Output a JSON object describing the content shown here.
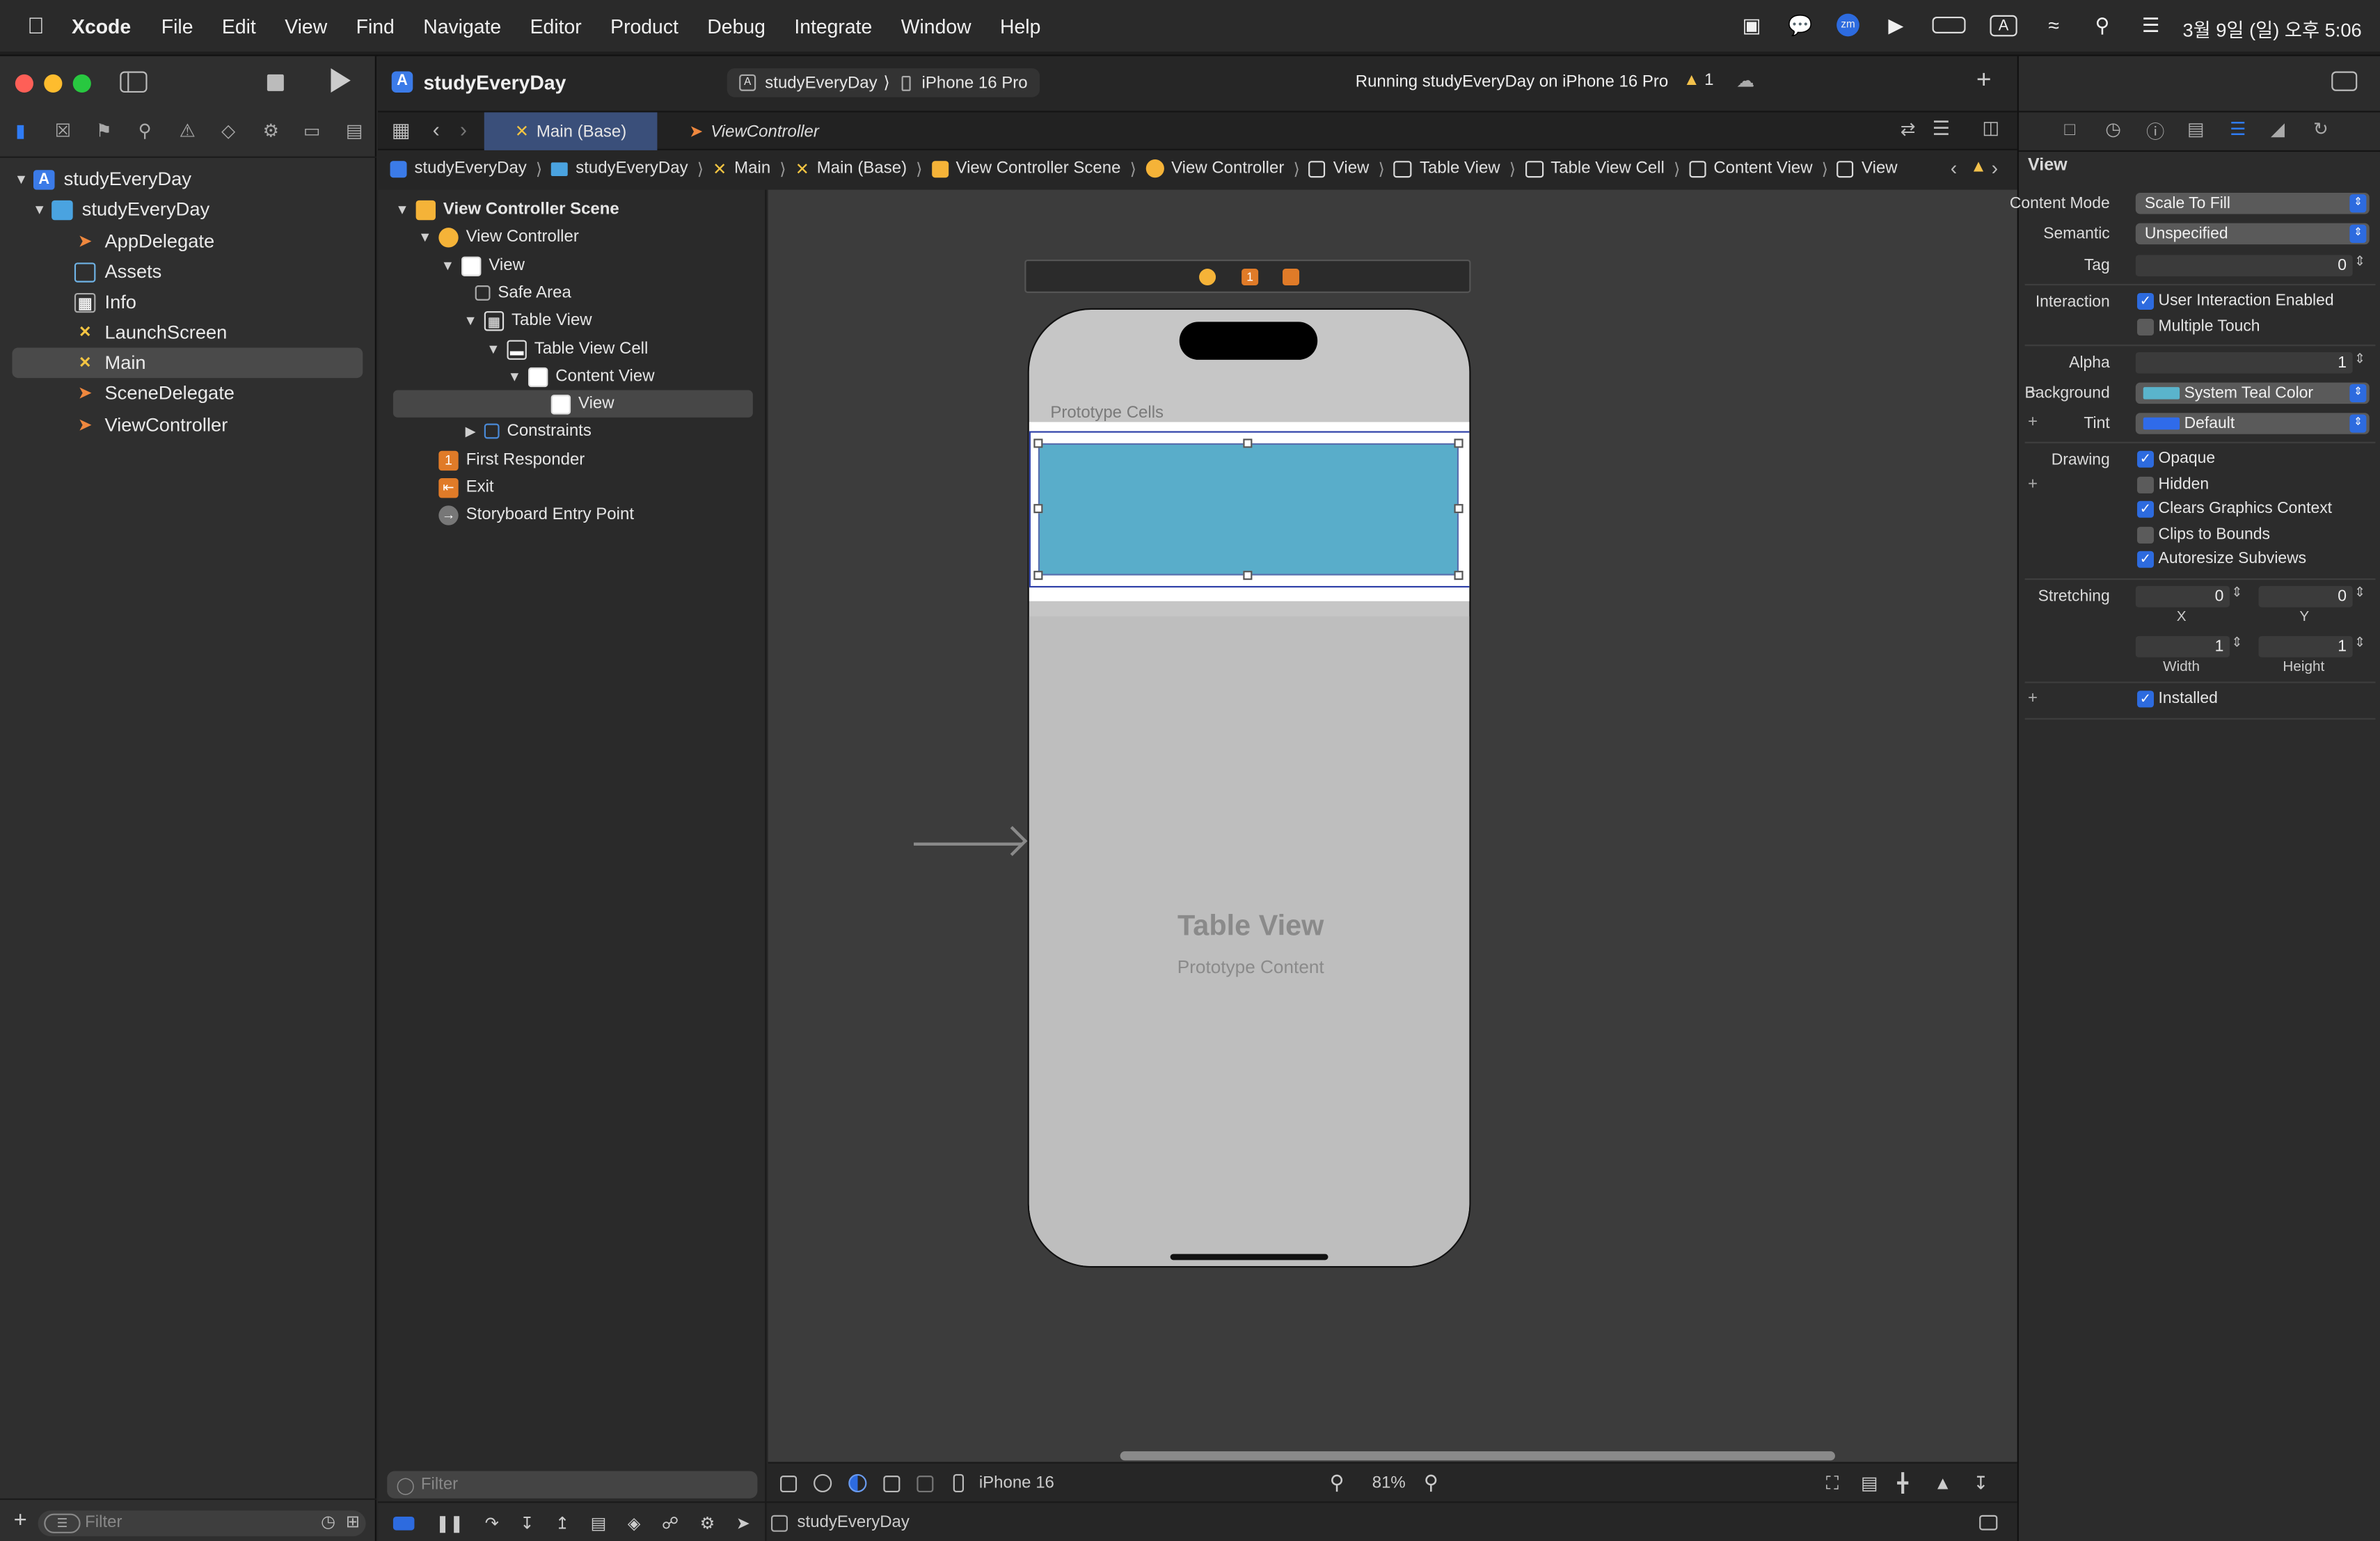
{
  "menubar": {
    "app": "Xcode",
    "items": [
      "File",
      "Edit",
      "View",
      "Find",
      "Navigate",
      "Editor",
      "Product",
      "Debug",
      "Integrate",
      "Window",
      "Help"
    ],
    "clock": "3월 9일 (일) 오후 5:06",
    "input_source": "A"
  },
  "toolbar": {
    "project": "studyEveryDay",
    "scheme": "studyEveryDay",
    "device": "iPhone 16 Pro",
    "status": "Running studyEveryDay on iPhone 16 Pro",
    "warning_count": "1"
  },
  "navigator": {
    "items": [
      {
        "label": "studyEveryDay",
        "icon": "project-icon",
        "level": 0,
        "chev": "⌄"
      },
      {
        "label": "studyEveryDay",
        "icon": "folder-icon",
        "level": 1,
        "chev": "⌄"
      },
      {
        "label": "AppDelegate",
        "icon": "swift-file-icon",
        "level": 2
      },
      {
        "label": "Assets",
        "icon": "assets-icon",
        "level": 2
      },
      {
        "label": "Info",
        "icon": "plist-icon",
        "level": 2
      },
      {
        "label": "LaunchScreen",
        "icon": "storyboard-icon",
        "level": 2
      },
      {
        "label": "Main",
        "icon": "storyboard-icon",
        "level": 2,
        "selected": true
      },
      {
        "label": "SceneDelegate",
        "icon": "swift-file-icon",
        "level": 2
      },
      {
        "label": "ViewController",
        "icon": "swift-file-icon",
        "level": 2
      }
    ],
    "filter_placeholder": "Filter"
  },
  "editor_tabs": [
    {
      "label": "Main (Base)",
      "active": true
    },
    {
      "label": "ViewController",
      "active": false
    }
  ],
  "breadcrumb": [
    "studyEveryDay",
    "studyEveryDay",
    "Main",
    "Main (Base)",
    "View Controller Scene",
    "View Controller",
    "View",
    "Table View",
    "Table View Cell",
    "Content View",
    "View"
  ],
  "outline": {
    "rows": [
      {
        "label": "View Controller Scene",
        "bold": true
      },
      {
        "label": "View Controller"
      },
      {
        "label": "View"
      },
      {
        "label": "Safe Area"
      },
      {
        "label": "Table View"
      },
      {
        "label": "Table View Cell"
      },
      {
        "label": "Content View"
      },
      {
        "label": "View",
        "selected": true
      },
      {
        "label": "Constraints"
      },
      {
        "label": "First Responder"
      },
      {
        "label": "Exit"
      },
      {
        "label": "Storyboard Entry Point"
      }
    ],
    "filter_placeholder": "Filter"
  },
  "canvas": {
    "prototype_cells_label": "Prototype Cells",
    "table_view_title": "Table View",
    "table_view_subtitle": "Prototype Content",
    "cell_view_color": "#59adca"
  },
  "canvas_bottom": {
    "device": "iPhone 16",
    "zoom": "81%"
  },
  "debug_bar": {
    "target": "studyEveryDay"
  },
  "inspector": {
    "section_title": "View",
    "content_mode_label": "Content Mode",
    "content_mode": "Scale To Fill",
    "semantic_label": "Semantic",
    "semantic": "Unspecified",
    "tag_label": "Tag",
    "tag": "0",
    "interaction_label": "Interaction",
    "user_interaction": "User Interaction Enabled",
    "multiple_touch": "Multiple Touch",
    "alpha_label": "Alpha",
    "alpha": "1",
    "background_label": "Background",
    "background": "System Teal Color",
    "background_color": "#5ab4cc",
    "tint_label": "Tint",
    "tint": "Default",
    "tint_color": "#2f6bea",
    "drawing_label": "Drawing",
    "opaque": "Opaque",
    "hidden": "Hidden",
    "clears_graphics": "Clears Graphics Context",
    "clips_to_bounds": "Clips to Bounds",
    "autoresize": "Autoresize Subviews",
    "stretching_label": "Stretching",
    "stretch_x": "0",
    "stretch_y": "0",
    "stretch_w": "1",
    "stretch_h": "1",
    "x_label": "X",
    "y_label": "Y",
    "width_label": "Width",
    "height_label": "Height",
    "installed": "Installed"
  }
}
